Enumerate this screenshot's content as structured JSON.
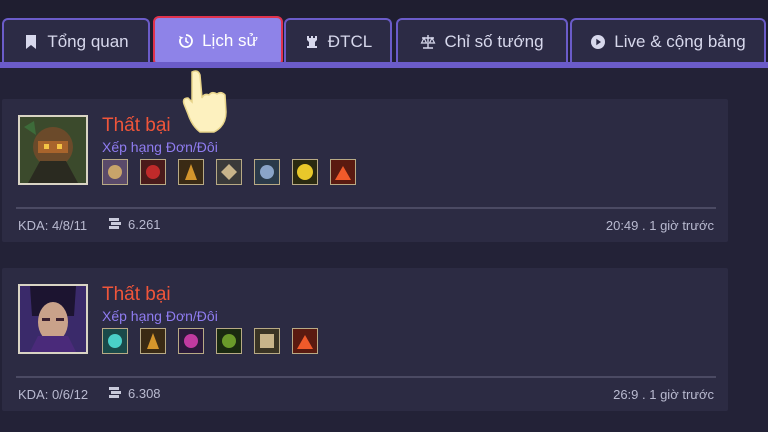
{
  "tabs": [
    {
      "label": "Tổng quan",
      "icon": "bookmark-icon",
      "active": false
    },
    {
      "label": "Lịch sử",
      "icon": "history-icon",
      "active": true
    },
    {
      "label": "ĐTCL",
      "icon": "rook-icon",
      "active": false
    },
    {
      "label": "Chỉ số tướng",
      "icon": "scale-icon",
      "active": false
    },
    {
      "label": "Live & cộng bảng",
      "icon": "play-circle-icon",
      "active": false
    }
  ],
  "matches": [
    {
      "result": "Thất bại",
      "queue": "Xếp hạng Đơn/Đôi",
      "item_count": 7,
      "kda": "KDA: 4/8/11",
      "gold": "6.261",
      "time": "20:49 . 1 giờ trước"
    },
    {
      "result": "Thất bại",
      "queue": "Xếp hạng Đơn/Đôi",
      "item_count": 6,
      "kda": "KDA: 0/6/12",
      "gold": "6.308",
      "time": "26:9 . 1 giờ trước"
    }
  ],
  "colors": {
    "accent": "#6b5cc9",
    "active_tab": "#8e83e8",
    "active_border": "#e0334e",
    "defeat": "#f0553a",
    "queue": "#8f7cf0"
  }
}
